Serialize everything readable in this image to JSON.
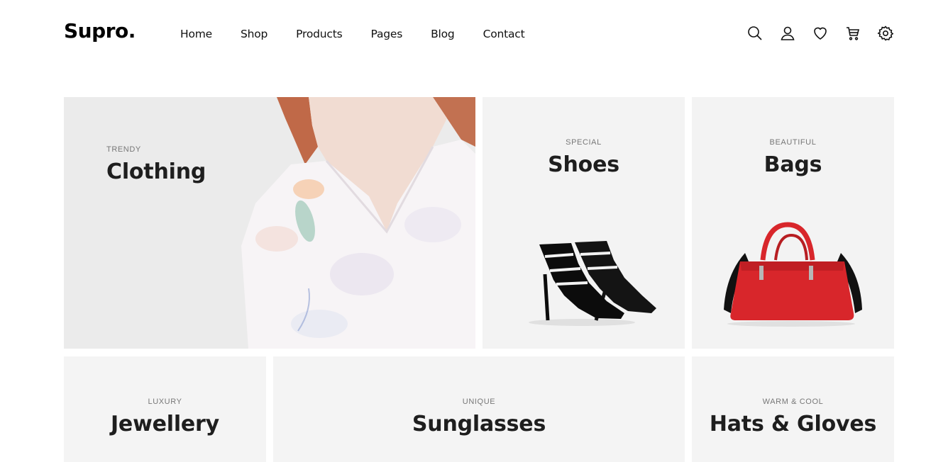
{
  "brand": {
    "logo": "Supro."
  },
  "nav": {
    "items": [
      "Home",
      "Shop",
      "Products",
      "Pages",
      "Blog",
      "Contact"
    ]
  },
  "header_icons": [
    "search-icon",
    "user-icon",
    "heart-icon",
    "cart-icon",
    "settings-icon"
  ],
  "categories": [
    {
      "kicker": "TRENDY",
      "title": "Clothing"
    },
    {
      "kicker": "SPECIAL",
      "title": "Shoes"
    },
    {
      "kicker": "BEAUTIFUL",
      "title": "Bags"
    },
    {
      "kicker": "LUXURY",
      "title": "Jewellery"
    },
    {
      "kicker": "UNIQUE",
      "title": "Sunglasses"
    },
    {
      "kicker": "WARM & COOL",
      "title": "Hats & Gloves"
    }
  ],
  "colors": {
    "text": "#1e1e1e",
    "tile_bg": "#f3f3f3",
    "bag_red": "#d8262b",
    "shoe_black": "#111111"
  }
}
